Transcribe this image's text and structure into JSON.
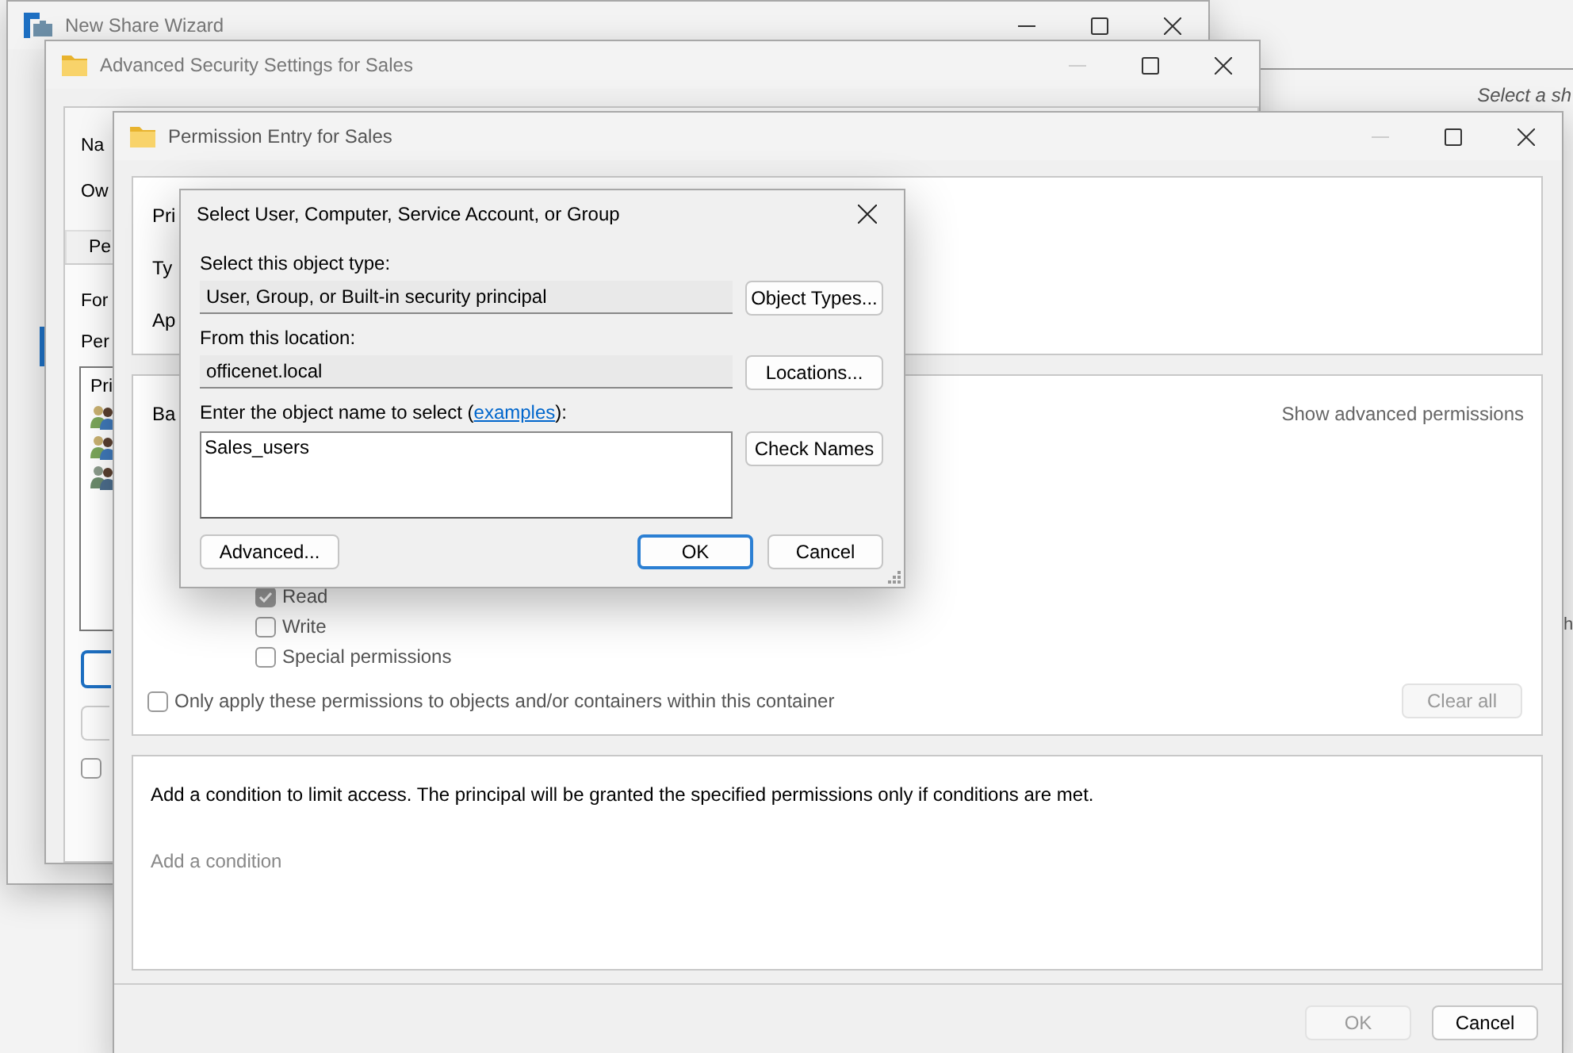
{
  "background_window": {
    "hint": "Select a sh",
    "fragment": "h"
  },
  "wizard_window": {
    "title": "New Share Wizard",
    "minimize_enabled": true
  },
  "advanced_window": {
    "title": "Advanced Security Settings for Sales",
    "minimize_enabled": false,
    "name_label": "Na",
    "owner_label": "Ow",
    "tab": "Pe",
    "for_label": "For",
    "permissions_label": "Per",
    "list_header": "Pri",
    "principals": [
      {
        "kind": "users"
      },
      {
        "kind": "users"
      },
      {
        "kind": "users_muted"
      }
    ],
    "checkbox": {
      "checked": false
    }
  },
  "permission_window": {
    "title": "Permission Entry for Sales",
    "minimize_enabled": false,
    "principal_label": "Pri",
    "type_label": "Ty",
    "applies_label": "Ap",
    "basic_label": "Ba",
    "show_advanced": "Show advanced permissions",
    "permissions": [
      {
        "label": "Read",
        "checked": true
      },
      {
        "label": "Write",
        "checked": false
      },
      {
        "label": "Special permissions",
        "checked": false
      }
    ],
    "only_apply": {
      "label": "Only apply these permissions to objects and/or containers within this container",
      "checked": false
    },
    "clear_all": {
      "label": "Clear all",
      "disabled": true
    },
    "condition_text": "Add a condition to limit access. The principal will be granted the specified permissions only if conditions are met.",
    "add_condition": "Add a condition",
    "ok": {
      "label": "OK",
      "disabled": true
    },
    "cancel": {
      "label": "Cancel",
      "disabled": false
    }
  },
  "select_dialog": {
    "title": "Select User, Computer, Service Account, or Group",
    "object_type_label": "Select this object type:",
    "object_type": "User, Group, or Built-in security principal",
    "object_types_button": "Object Types...",
    "location_label": "From this location:",
    "location": "officenet.local",
    "locations_button": "Locations...",
    "name_prompt": {
      "before": "Enter the object name to select (",
      "link": "examples",
      "after": "):"
    },
    "object_name": "Sales_users",
    "check_names_button": "Check Names",
    "advanced_button": "Advanced...",
    "ok_button": "OK",
    "cancel_button": "Cancel"
  }
}
